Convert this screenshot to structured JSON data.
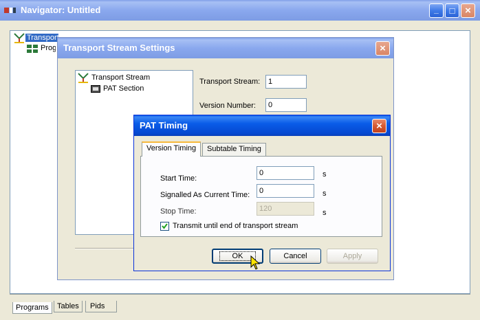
{
  "navigator": {
    "title": "Navigator: Untitled",
    "tree": [
      {
        "label": "Transport Stream",
        "level": 0
      },
      {
        "label": "Programs",
        "level": 1
      }
    ],
    "bottom_tabs": [
      "Programs",
      "Tables",
      "Pids"
    ]
  },
  "ts_settings": {
    "title": "Transport Stream Settings",
    "tree": [
      {
        "label": "Transport Stream"
      },
      {
        "label": "PAT Section"
      }
    ],
    "fields": [
      {
        "label": "Transport Stream:",
        "value": "1"
      },
      {
        "label": "Version Number:",
        "value": "0"
      }
    ]
  },
  "pat_timing": {
    "title": "PAT Timing",
    "tabs": [
      "Version Timing",
      "Subtable Timing"
    ],
    "rows": [
      {
        "label": "Start Time:",
        "value": "0",
        "unit": "s"
      },
      {
        "label": "Signalled As Current Time:",
        "value": "0",
        "unit": "s"
      },
      {
        "label": "Stop Time:",
        "value": "120",
        "unit": "s"
      }
    ],
    "checkbox_label": "Transmit until end of transport stream",
    "checkbox_checked": true,
    "buttons": {
      "ok": "OK",
      "cancel": "Cancel",
      "apply": "Apply"
    }
  },
  "icons": {
    "close": "×",
    "minimize": "_",
    "maximize": "□"
  },
  "colors": {
    "title_active": "#0a5ce8",
    "dialog_bg": "#ece9d8",
    "close_red": "#d65a31"
  }
}
